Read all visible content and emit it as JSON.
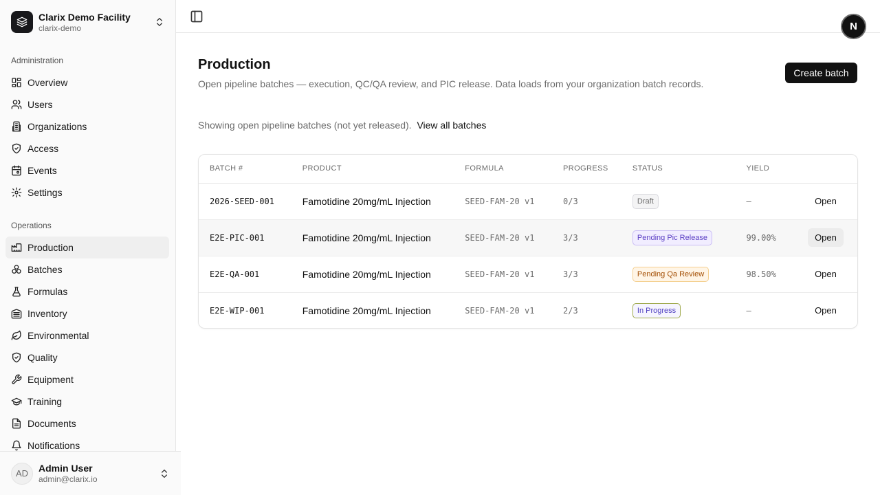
{
  "org": {
    "name": "Clarix Demo Facility",
    "slug": "clarix-demo"
  },
  "sidebar": {
    "admin_label": "Administration",
    "admin_items": [
      {
        "label": "Overview",
        "icon": "overview-icon"
      },
      {
        "label": "Users",
        "icon": "users-icon"
      },
      {
        "label": "Organizations",
        "icon": "building-icon"
      },
      {
        "label": "Access",
        "icon": "shield-check-icon"
      },
      {
        "label": "Events",
        "icon": "calendar-icon"
      },
      {
        "label": "Settings",
        "icon": "gear-icon"
      }
    ],
    "ops_label": "Operations",
    "ops_items": [
      {
        "label": "Production",
        "icon": "factory-icon",
        "active": true
      },
      {
        "label": "Batches",
        "icon": "boxes-icon"
      },
      {
        "label": "Formulas",
        "icon": "flask-icon"
      },
      {
        "label": "Inventory",
        "icon": "warehouse-icon"
      },
      {
        "label": "Environmental",
        "icon": "leaf-icon"
      },
      {
        "label": "Quality",
        "icon": "shield-check-icon"
      },
      {
        "label": "Equipment",
        "icon": "wrench-icon"
      },
      {
        "label": "Training",
        "icon": "graduation-cap-icon"
      },
      {
        "label": "Documents",
        "icon": "document-icon"
      },
      {
        "label": "Notifications",
        "icon": "bell-icon"
      }
    ]
  },
  "user": {
    "initials": "AD",
    "name": "Admin User",
    "email": "admin@clarix.io"
  },
  "profile_badge": "N",
  "page": {
    "title": "Production",
    "description": "Open pipeline batches — execution, QC/QA review, and PIC release. Data loads from your organization batch records.",
    "create_button": "Create batch",
    "filter_text": "Showing open pipeline batches (not yet released).",
    "view_all_link": "View all batches"
  },
  "table": {
    "headers": [
      "BATCH #",
      "PRODUCT",
      "FORMULA",
      "PROGRESS",
      "STATUS",
      "YIELD",
      ""
    ],
    "rows": [
      {
        "batch": "2026-SEED-001",
        "product": "Famotidine 20mg/mL Injection",
        "formula": "SEED-FAM-20 v1",
        "progress": "0/3",
        "status": "Draft",
        "status_style": "draft",
        "yield": "—",
        "action": "Open"
      },
      {
        "batch": "E2E-PIC-001",
        "product": "Famotidine 20mg/mL Injection",
        "formula": "SEED-FAM-20 v1",
        "progress": "3/3",
        "status": "Pending Pic Release",
        "status_style": "pic",
        "yield": "99.00%",
        "action": "Open",
        "hovered": true
      },
      {
        "batch": "E2E-QA-001",
        "product": "Famotidine 20mg/mL Injection",
        "formula": "SEED-FAM-20 v1",
        "progress": "3/3",
        "status": "Pending Qa Review",
        "status_style": "qa",
        "yield": "98.50%",
        "action": "Open"
      },
      {
        "batch": "E2E-WIP-001",
        "product": "Famotidine 20mg/mL Injection",
        "formula": "SEED-FAM-20 v1",
        "progress": "2/3",
        "status": "In Progress",
        "status_style": "wip",
        "yield": "—",
        "action": "Open"
      }
    ]
  },
  "status_colors": {
    "draft": {
      "bg": "#f4f4f5",
      "border": "#d9d9de",
      "text": "#6b6b6b"
    },
    "pic": {
      "bg": "#f1edff",
      "border": "#c9bdf4",
      "text": "#5b3fc4"
    },
    "qa": {
      "bg": "#fff5e6",
      "border": "#f4cf8e",
      "text": "#a24c00"
    },
    "wip": {
      "bg": "#f6f5ff",
      "border": "#9ea84a",
      "text": "#4c3cbf"
    }
  }
}
